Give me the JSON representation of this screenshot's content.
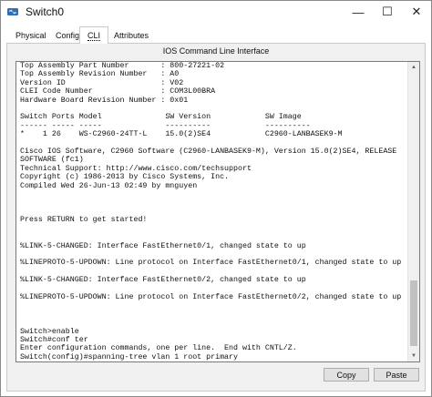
{
  "window": {
    "title": "Switch0",
    "minimize_glyph": "—",
    "maximize_glyph": "☐",
    "close_glyph": "✕",
    "icon": "cisco-switch-icon"
  },
  "tabs": [
    {
      "label": "Physical",
      "selected": false
    },
    {
      "label": "Config",
      "selected": false
    },
    {
      "label": "CLI",
      "selected": true
    },
    {
      "label": "Attributes",
      "selected": false
    }
  ],
  "cli": {
    "header": "IOS Command Line Interface",
    "console_lines": [
      "Top Assembly Part Number       : 800-27221-02",
      "Top Assembly Revision Number   : A0",
      "Version ID                     : V02",
      "CLEI Code Number               : COM3L00BRA",
      "Hardware Board Revision Number : 0x01",
      "",
      "Switch Ports Model              SW Version            SW Image",
      "------ ----- -----              ----------            ----------",
      "*    1 26    WS-C2960-24TT-L    15.0(2)SE4            C2960-LANBASEK9-M",
      "",
      "Cisco IOS Software, C2960 Software (C2960-LANBASEK9-M), Version 15.0(2)SE4, RELEASE",
      "SOFTWARE (fc1)",
      "Technical Support: http://www.cisco.com/techsupport",
      "Copyright (c) 1986-2013 by Cisco Systems, Inc.",
      "Compiled Wed 26-Jun-13 02:49 by mnguyen",
      "",
      "",
      "",
      "Press RETURN to get started!",
      "",
      "",
      "%LINK-5-CHANGED: Interface FastEthernet0/1, changed state to up",
      "",
      "%LINEPROTO-5-UPDOWN: Line protocol on Interface FastEthernet0/1, changed state to up",
      "",
      "%LINK-5-CHANGED: Interface FastEthernet0/2, changed state to up",
      "",
      "%LINEPROTO-5-UPDOWN: Line protocol on Interface FastEthernet0/2, changed state to up",
      "",
      "",
      "",
      "Switch>enable",
      "Switch#conf ter",
      "Enter configuration commands, one per line.  End with CNTL/Z.",
      "Switch(config)#spanning-tree vlan 1 root primary",
      "Switch(config)#"
    ]
  },
  "buttons": {
    "copy": "Copy",
    "paste": "Paste"
  }
}
